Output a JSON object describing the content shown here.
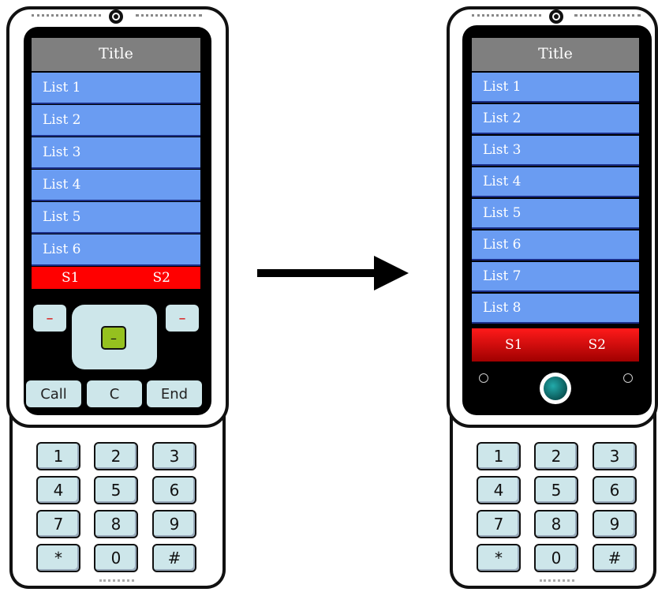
{
  "left_phone": {
    "title": "Title",
    "list": [
      "List 1",
      "List 2",
      "List 3",
      "List 4",
      "List 5",
      "List 6"
    ],
    "soft_left": "S1",
    "soft_right": "S2",
    "side_key_symbol": "–",
    "center_key_symbol": "–",
    "call_label": "Call",
    "clear_label": "C",
    "end_label": "End"
  },
  "right_phone": {
    "title": "Title",
    "list": [
      "List 1",
      "List 2",
      "List 3",
      "List 4",
      "List 5",
      "List 6",
      "List 7",
      "List 8"
    ],
    "soft_left": "S1",
    "soft_right": "S2"
  },
  "keypad": [
    "1",
    "2",
    "3",
    "4",
    "5",
    "6",
    "7",
    "8",
    "9",
    "*",
    "0",
    "#"
  ],
  "colors": {
    "list_blue": "#6a9cf2",
    "title_gray": "#7f7f7f",
    "softbar_red": "#ff0000",
    "key_blue": "#cde6ea",
    "center_green": "#95c11f"
  }
}
